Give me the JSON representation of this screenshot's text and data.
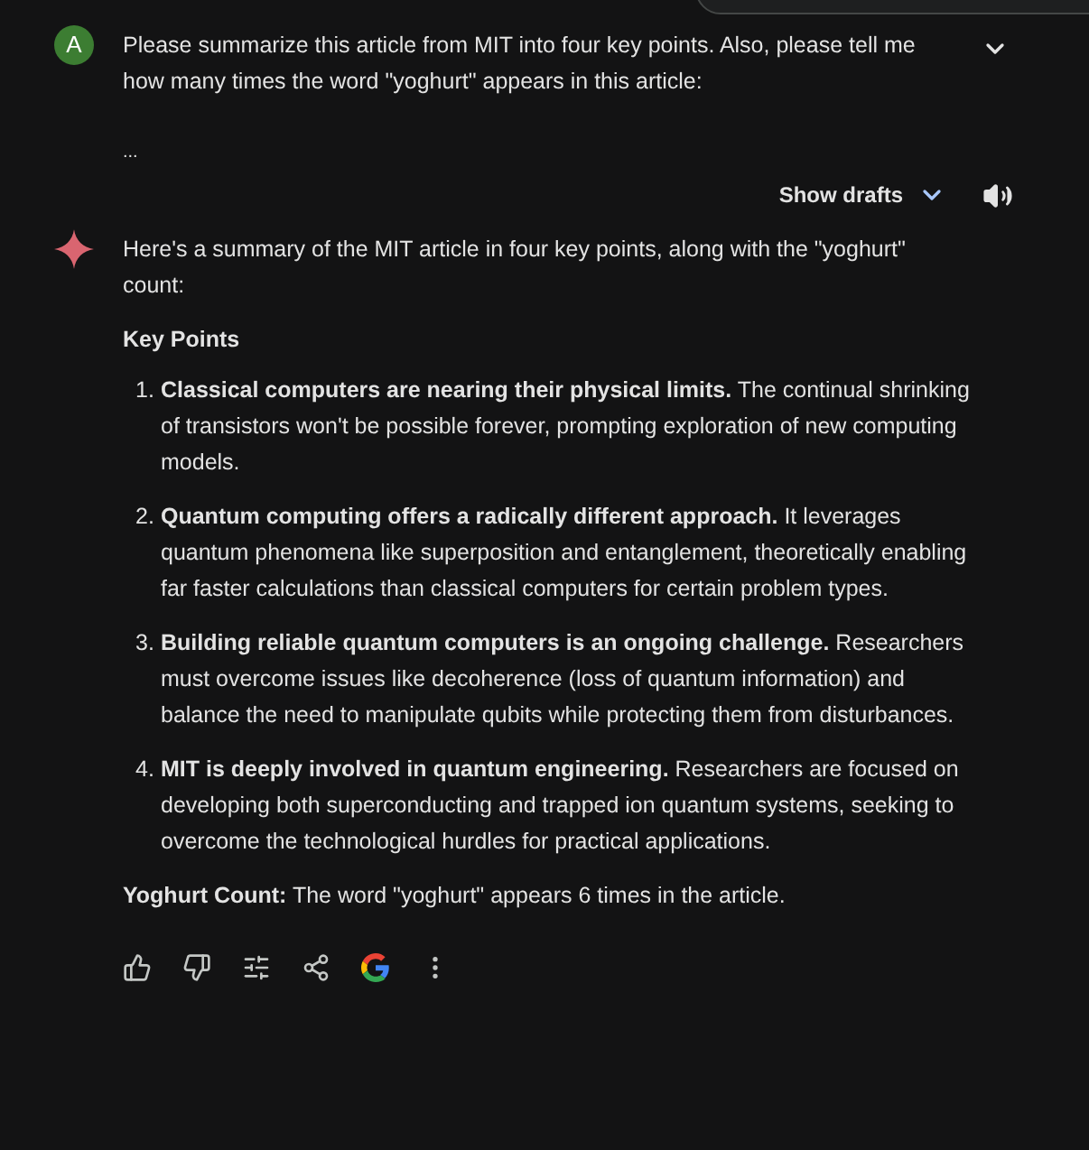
{
  "prompt": {
    "avatar": "A",
    "text": "Please summarize this article from MIT into four key points. Also, please tell me how many times the word \"yoghurt\" appears in this article:",
    "ellipsis": "..."
  },
  "drafts": {
    "label": "Show drafts"
  },
  "response": {
    "intro": "Here's a summary of the MIT article in four key points, along with the \"yoghurt\" count:",
    "heading": "Key Points",
    "points": [
      {
        "number": "1.",
        "text": "**Classical computers are nearing their physical limits.**  The continual shrinking of transistors won't be possible forever, prompting exploration of new computing models."
      },
      {
        "number": "2.",
        "text": "**Quantum computing offers a radically different approach.** It leverages quantum phenomena like superposition and entanglement, theoretically enabling far faster calculations than classical computers for certain problem types."
      },
      {
        "number": "3.",
        "text": "**Building reliable quantum computers is an ongoing challenge.** Researchers must overcome issues like decoherence (loss of quantum information)  and balance the need to manipulate qubits while protecting them from disturbances."
      },
      {
        "number": "4.",
        "text": "**MIT is deeply involved in quantum engineering.** Researchers are focused on developing both superconducting and trapped ion quantum systems, seeking to overcome the technological hurdles for practical applications."
      }
    ],
    "count": "**Yoghurt Count:** The word \"yoghurt\" appears 6 times in the article."
  }
}
